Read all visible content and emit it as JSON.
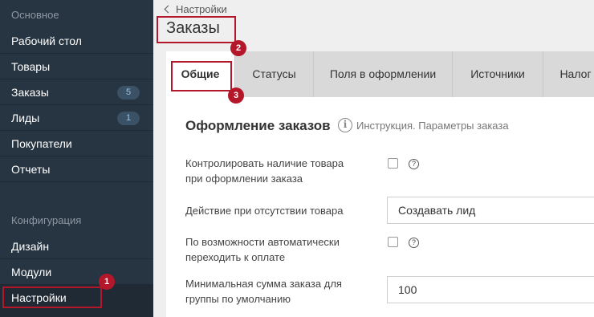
{
  "sidebar": {
    "section_main": "Основное",
    "section_config": "Конфигурация",
    "items": [
      {
        "label": "Рабочий стол"
      },
      {
        "label": "Товары"
      },
      {
        "label": "Заказы",
        "badge": "5"
      },
      {
        "label": "Лиды",
        "badge": "1"
      },
      {
        "label": "Покупатели"
      },
      {
        "label": "Отчеты"
      }
    ],
    "config_items": [
      {
        "label": "Дизайн"
      },
      {
        "label": "Модули"
      },
      {
        "label": "Настройки"
      }
    ]
  },
  "breadcrumb": {
    "back_label": "Настройки"
  },
  "page": {
    "title": "Заказы"
  },
  "tabs": [
    {
      "label": "Общие"
    },
    {
      "label": "Статусы"
    },
    {
      "label": "Поля в оформлении"
    },
    {
      "label": "Источники"
    },
    {
      "label": "Налог"
    }
  ],
  "section": {
    "title": "Оформление заказов",
    "link": "Инструкция. Параметры заказа"
  },
  "rows": {
    "check_stock": {
      "line1": "Контролировать наличие товара",
      "line2": "при оформлении заказа"
    },
    "no_stock_action": {
      "label": "Действие при отсутствии товара",
      "value": "Создавать лид"
    },
    "auto_payment": {
      "line1": "По возможности автоматически",
      "line2": "переходить к оплате"
    },
    "min_sum": {
      "line1": "Минимальная сумма заказа для",
      "line2": "группы по умолчанию",
      "value": "100"
    }
  },
  "markers": {
    "m1": "1",
    "m2": "2",
    "m3": "3"
  },
  "colors": {
    "sidebar_bg": "#273441",
    "annotation": "#b5172a",
    "badge_bg": "#3b5166"
  }
}
